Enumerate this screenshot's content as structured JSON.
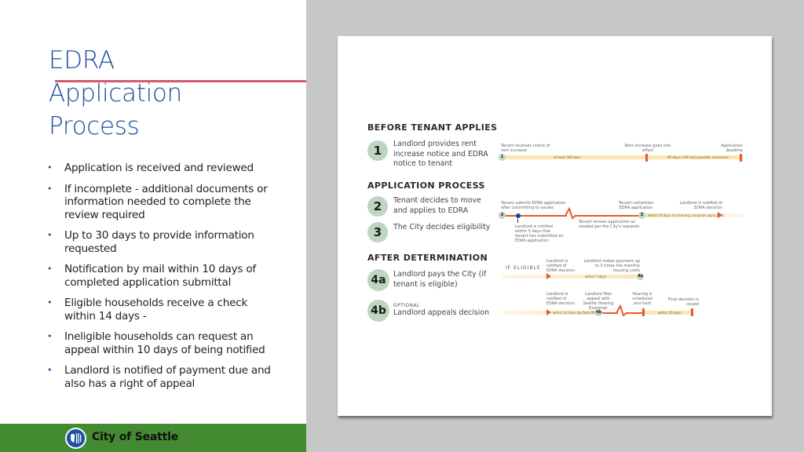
{
  "slide": {
    "title_lines": [
      "EDRA",
      "Application",
      "Process"
    ],
    "bullets": [
      "Application is received and reviewed",
      "If incomplete - additional documents or information needed to complete the review required",
      "Up to 30 days to provide information requested",
      "Notification by mail within 10 days of completed application submittal",
      "Eligible households receive a check within 14 days -",
      "Ineligible households can request an appeal within 10 days of being notified",
      "Landlord is notified of payment due and also has a right of appeal"
    ],
    "footer": {
      "org_name": "City of Seattle",
      "logo_icon": "city-of-seattle-logo-icon"
    }
  },
  "colors": {
    "title": "#1f4fa0",
    "accent_rule": "#d15a72",
    "footer_bg": "#438a31",
    "gray_bg": "#c6c8c7",
    "step_circle": "#bcd6c0",
    "timeline_orange": "#e8582c",
    "timeline_bar": "#fbe6b3"
  },
  "diagram": {
    "sections": [
      {
        "heading": "BEFORE TENANT APPLIES",
        "steps": [
          {
            "number": "1",
            "text": "Landlord provides rent increase notice and EDRA notice to tenant",
            "timeline": {
              "labels": [
                "Tenant receives notice of rent increase",
                "Rent increase goes into effect",
                "Application deadline"
              ],
              "bar_labels": [
                "at least 180 days",
                "90 days (+90 days possible extension)"
              ]
            }
          }
        ]
      },
      {
        "heading": "APPLICATION PROCESS",
        "steps": [
          {
            "number": "2",
            "text": "Tenant decides to move and applies to EDRA",
            "timeline": {
              "labels": [
                "Tenant submits EDRA application after committing to vacate",
                "Tenant completes EDRA application",
                "Landlord is notified of EDRA decision"
              ],
              "notes": [
                "Landlord is notified within 5 days that tenant has submitted an EDRA application",
                "Tenant revises application as needed per the City's requests"
              ],
              "bar_labels": [
                "within 10 days of receiving complete application"
              ]
            }
          },
          {
            "number": "3",
            "text": "The City decides eligibility"
          }
        ]
      },
      {
        "heading": "AFTER DETERMINATION",
        "steps": [
          {
            "number": "4a",
            "text": "Landlord pays the City (if tenant is eligible)",
            "timeline": {
              "prefix": "IF ELIGIBLE",
              "labels": [
                "Landlord is notified of EDRA decision",
                "Landlord makes payment up to 3 times the monthly housing costs"
              ],
              "bar_labels": [
                "within 7 days"
              ]
            }
          },
          {
            "number": "4b",
            "optional_tag": "OPTIONAL",
            "text": "Landlord appeals decision",
            "timeline": {
              "labels": [
                "Landlord is notified of EDRA decision",
                "Landlord files appeal with Seattle Hearing Examiner",
                "Hearing is scheduled and held",
                "Final decision is issued"
              ],
              "bar_labels": [
                "within 10 days (by 5pm PST)",
                "within 20 days"
              ]
            }
          }
        ]
      }
    ]
  }
}
